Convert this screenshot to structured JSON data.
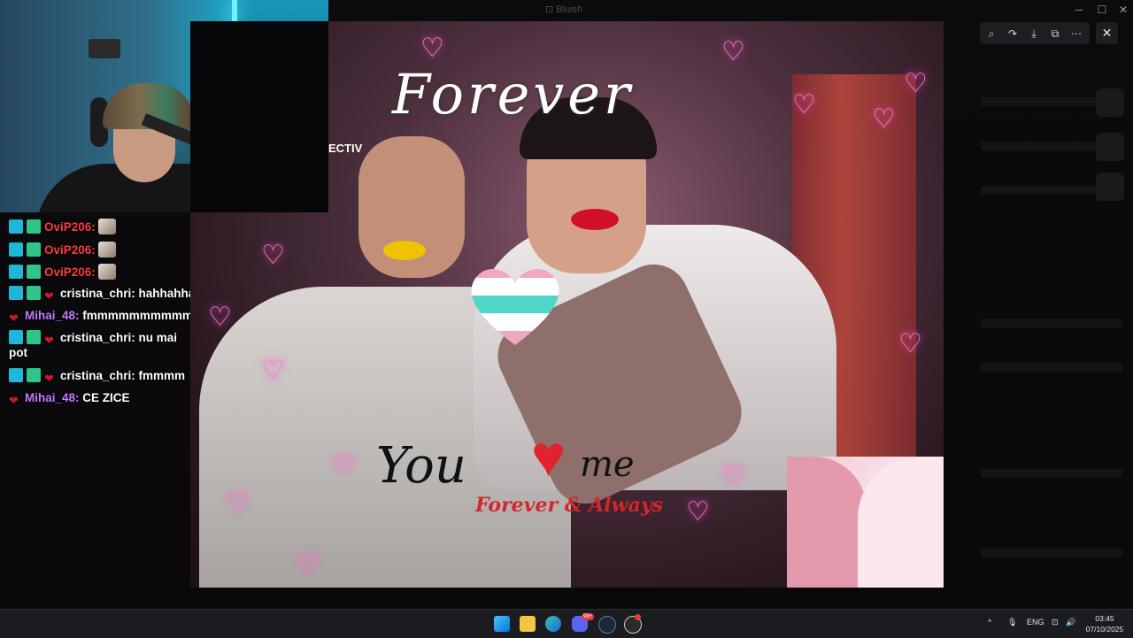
{
  "window": {
    "title": "⊡ Bluish",
    "minimize": "─",
    "maximize": "☐",
    "close": "✕"
  },
  "chat": {
    "messages": [
      {
        "user": "OviP206",
        "text": "",
        "badges": [
          "mod",
          "og"
        ],
        "user_color": "#ff3b3b",
        "emote": true
      },
      {
        "user": "OviP206",
        "text": "",
        "badges": [
          "mod",
          "og"
        ],
        "user_color": "#ff3b3b",
        "emote": true
      },
      {
        "user": "OviP206",
        "text": "",
        "badges": [
          "mod",
          "og"
        ],
        "user_color": "#ff3b3b",
        "emote": true
      },
      {
        "user": "cristina_chri",
        "text": "hahhahha",
        "badges": [
          "mod",
          "og",
          "heart"
        ]
      },
      {
        "user": "Mihai_48",
        "text": "fmmmmmmmmmm",
        "badges": [
          "heart"
        ],
        "user_color": "#c07cff"
      },
      {
        "user": "cristina_chri",
        "text": "nu mai pot",
        "badges": [
          "mod",
          "og",
          "heart"
        ]
      },
      {
        "user": "cristina_chri",
        "text": "fmmmm",
        "badges": [
          "mod",
          "og",
          "heart"
        ]
      },
      {
        "user": "Mihai_48",
        "text": "CE ZICE",
        "badges": [
          "heart"
        ],
        "user_color": "#c07cff"
      }
    ]
  },
  "meme": {
    "forever_text": "Forever",
    "you_text": "You",
    "me_text": "me",
    "forever_always": "Forever & Always",
    "partial_sign": "ECTIV"
  },
  "viewer_toolbar": {
    "zoom_icon": "zoom-icon",
    "rotate_icon": "rotate-icon",
    "download_icon": "download-icon",
    "open_external_icon": "open-external-icon",
    "more_icon": "more-icon",
    "close_icon": "close-icon"
  },
  "taskbar": {
    "apps": [
      "windows-start",
      "file-explorer",
      "edge",
      "discord",
      "steam",
      "obs"
    ],
    "discord_badge": "99+",
    "tray": {
      "language": "ENG"
    },
    "clock": {
      "time": "03:45",
      "date": "07/10/2025"
    }
  },
  "colors": {
    "mod_badge": "#1fb6d8",
    "og_badge": "#2ec48a",
    "heart_badge": "#c61b2b",
    "red_user": "#ff3b3b",
    "purple_user": "#c07cff",
    "neon_pink": "#ff7fd0"
  }
}
